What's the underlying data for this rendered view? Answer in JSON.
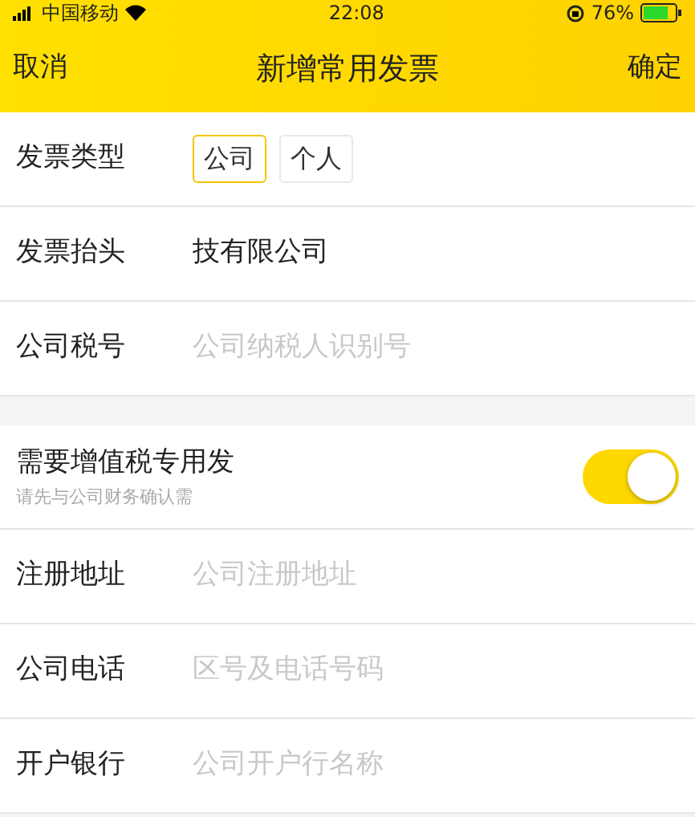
{
  "status_bar": {
    "carrier": "中国移动",
    "time": "22:08",
    "battery": "76%"
  },
  "nav": {
    "cancel": "取消",
    "title": "新增常用发票",
    "confirm": "确定"
  },
  "invoice_type": {
    "label": "发票类型",
    "options": [
      {
        "label": "公司",
        "selected": true
      },
      {
        "label": "个人",
        "selected": false
      }
    ]
  },
  "fields_top": [
    {
      "label": "发票抬头",
      "value": "技有限公司"
    },
    {
      "label": "公司税号",
      "placeholder": "公司纳税人识别号"
    }
  ],
  "vat_toggle": {
    "label": "需要增值税专用发",
    "hint": "请先与公司财务确认需",
    "on": true
  },
  "fields_bottom": [
    {
      "label": "注册地址",
      "placeholder": "公司注册地址"
    },
    {
      "label": "公司电话",
      "placeholder": "区号及电话号码"
    },
    {
      "label": "开户银行",
      "placeholder": "公司开户行名称"
    }
  ]
}
